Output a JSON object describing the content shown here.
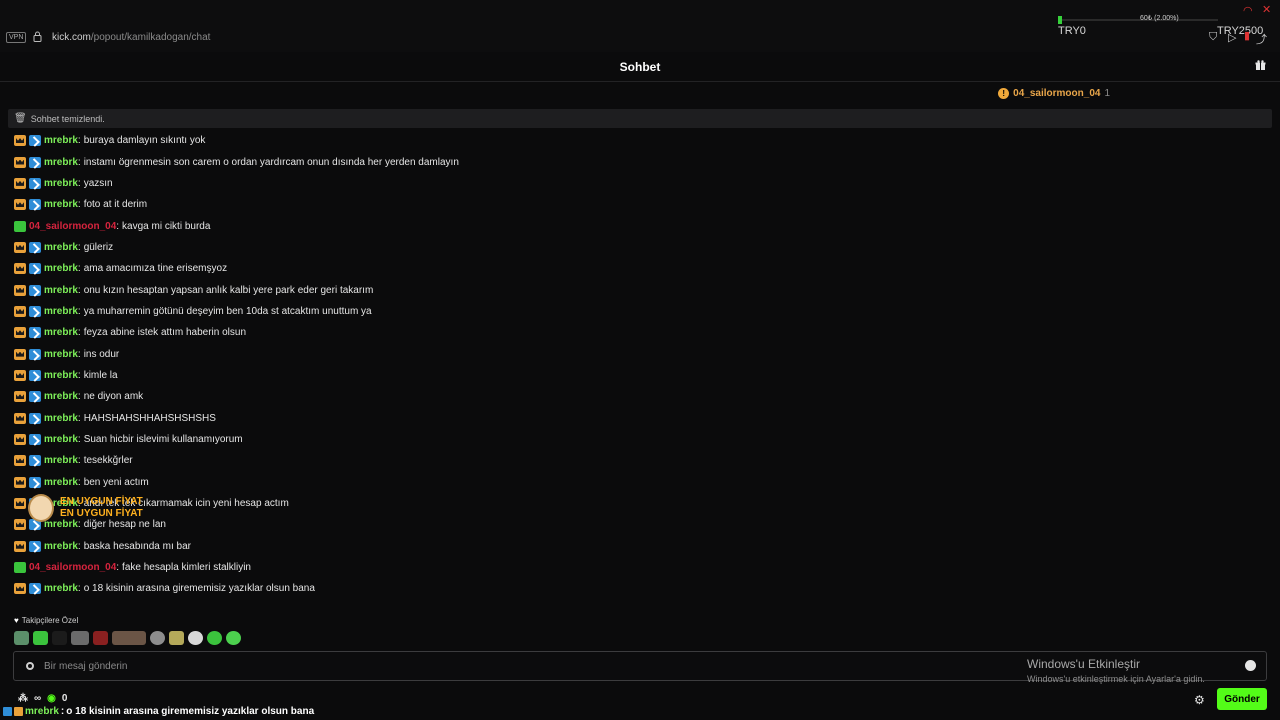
{
  "browser": {
    "vpn_label": "VPN",
    "url_host": "kick.com",
    "url_path": "/popout/kamilkadogan/chat"
  },
  "overlay": {
    "percent_text": "60₺ (2.00%)",
    "progress_fraction": 0.02,
    "left_amount": "TRY0",
    "right_amount": "TRY2500"
  },
  "header": {
    "title": "Sohbet"
  },
  "pinned": {
    "user": "04_sailormoon_04",
    "count": "1"
  },
  "cleared_notice": "Sohbet temizlendi.",
  "messages": [
    {
      "user": "mrebrk",
      "color": "green",
      "badges": [
        "crown",
        "blue"
      ],
      "text": "buraya damlayın sıkıntı yok"
    },
    {
      "user": "mrebrk",
      "color": "green",
      "badges": [
        "crown",
        "blue"
      ],
      "text": "instamı ögrenmesin son carem o ordan yardırcam onun dısında her yerden damlayın"
    },
    {
      "user": "mrebrk",
      "color": "green",
      "badges": [
        "crown",
        "blue"
      ],
      "text": "yazsın"
    },
    {
      "user": "mrebrk",
      "color": "green",
      "badges": [
        "crown",
        "blue"
      ],
      "text": "foto at it derim"
    },
    {
      "user": "04_sailormoon_04",
      "color": "red",
      "badges": [
        "gift"
      ],
      "text": "kavga mi cikti burda"
    },
    {
      "user": "mrebrk",
      "color": "green",
      "badges": [
        "crown",
        "blue"
      ],
      "text": "güleriz"
    },
    {
      "user": "mrebrk",
      "color": "green",
      "badges": [
        "crown",
        "blue"
      ],
      "text": "ama amacımıza tine erisemşyoz"
    },
    {
      "user": "mrebrk",
      "color": "green",
      "badges": [
        "crown",
        "blue"
      ],
      "text": "onu kızın hesaptan yapsan anlık kalbi yere park eder geri takarım"
    },
    {
      "user": "mrebrk",
      "color": "green",
      "badges": [
        "crown",
        "blue"
      ],
      "text": "ya muharremin götünü deşeyim ben 10da st atcaktım unuttum ya"
    },
    {
      "user": "mrebrk",
      "color": "green",
      "badges": [
        "crown",
        "blue"
      ],
      "text": "feyza abine istek attım haberin olsun"
    },
    {
      "user": "mrebrk",
      "color": "green",
      "badges": [
        "crown",
        "blue"
      ],
      "text": "ins odur"
    },
    {
      "user": "mrebrk",
      "color": "green",
      "badges": [
        "crown",
        "blue"
      ],
      "text": "kimle la"
    },
    {
      "user": "mrebrk",
      "color": "green",
      "badges": [
        "crown",
        "blue"
      ],
      "text": "ne diyon amk"
    },
    {
      "user": "mrebrk",
      "color": "green",
      "badges": [
        "crown",
        "blue"
      ],
      "text": "HAHSHAHSHHAHSHSHSHS"
    },
    {
      "user": "mrebrk",
      "color": "green",
      "badges": [
        "crown",
        "blue"
      ],
      "text": "Suan hicbir islevimi kullanamıyorum"
    },
    {
      "user": "mrebrk",
      "color": "green",
      "badges": [
        "crown",
        "blue"
      ],
      "text": "tesekkğrler"
    },
    {
      "user": "mrebrk",
      "color": "green",
      "badges": [
        "crown",
        "blue"
      ],
      "text": "ben yeni actım"
    },
    {
      "user": "mrebrk",
      "color": "green",
      "badges": [
        "crown",
        "blue"
      ],
      "text": "andı tek tek cıkarmamak icin yeni hesap actım"
    },
    {
      "user": "mrebrk",
      "color": "green",
      "badges": [
        "crown",
        "blue"
      ],
      "text": "diğer hesap ne lan"
    },
    {
      "user": "mrebrk",
      "color": "green",
      "badges": [
        "crown",
        "blue"
      ],
      "text": "baska hesabında mı bar"
    },
    {
      "user": "04_sailormoon_04",
      "color": "red",
      "badges": [
        "gift"
      ],
      "text": "fake hesapla kimleri stalkliyin"
    },
    {
      "user": "mrebrk",
      "color": "green",
      "badges": [
        "crown",
        "blue"
      ],
      "text": "o 18 kisinin arasına girememisiz yazıklar olsun bana"
    }
  ],
  "promo": {
    "line1": "EN UYGUN FİYAT",
    "line2": "EN UYGUN FİYAT"
  },
  "followers_only_label": "Takipçilere Özel",
  "input": {
    "placeholder": "Bir mesaj gönderin"
  },
  "windows_watermark": {
    "line1": "Windows'u Etkinleştir",
    "line2": "Windows'u etkinleştirmek için Ayarlar'a gidin."
  },
  "bottom": {
    "count": "0",
    "send_label": "Gönder"
  },
  "ticker": {
    "user": "mrebrk",
    "text": "o 18 kisinin arasına girememisiz yazıklar olsun bana"
  },
  "colors": {
    "accent": "#53fc18",
    "user_green": "#7ef05a",
    "user_red": "#d6243e",
    "crown": "#e9a13a",
    "blue_badge": "#2f8ed8"
  }
}
